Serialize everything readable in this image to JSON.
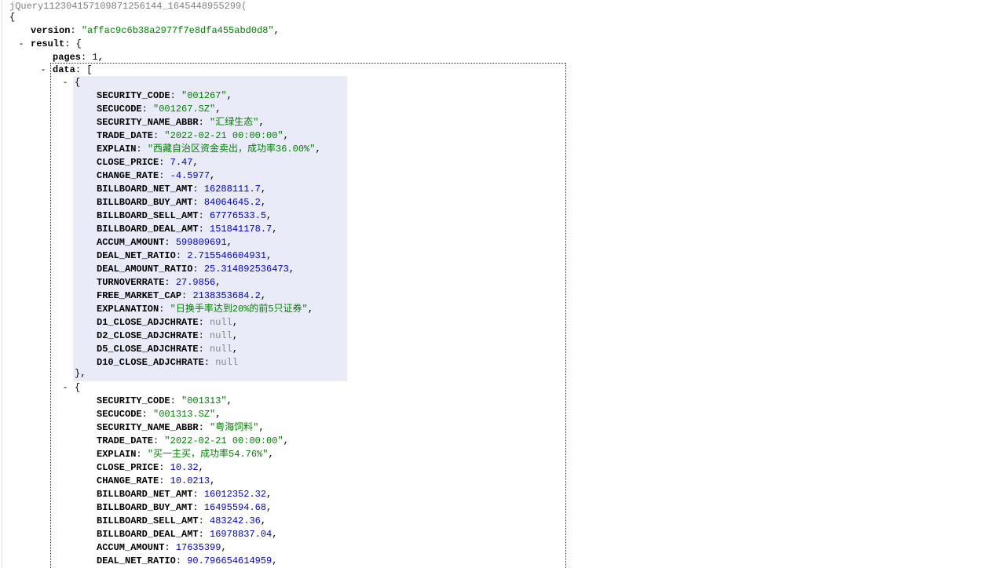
{
  "callback": "jQuery1123041571098712561­44_1645448955299(",
  "open_brace": "{",
  "root": {
    "version_key": "version",
    "version_value": "\"affac9c6b38a2977f7e8dfa455abd0d8\"",
    "result_key": "result",
    "pages_key": "pages",
    "pages_value": "1",
    "data_key": "data",
    "bracket_open": "[",
    "obj_open": "{",
    "obj_close": "},",
    "toggle_symbol": "-"
  },
  "records": [
    {
      "fields": [
        {
          "key": "SECURITY_CODE",
          "value": "\"001267\"",
          "type": "str",
          "sep": ","
        },
        {
          "key": "SECUCODE",
          "value": "\"001267.SZ\"",
          "type": "str",
          "sep": ","
        },
        {
          "key": "SECURITY_NAME_ABBR",
          "value": "\"汇绿生态\"",
          "type": "str",
          "sep": ","
        },
        {
          "key": "TRADE_DATE",
          "value": "\"2022-02-21 00:00:00\"",
          "type": "str",
          "sep": ","
        },
        {
          "key": "EXPLAIN",
          "value": "\"西藏自治区资金卖出，成功率36.00%\"",
          "type": "str",
          "sep": ","
        },
        {
          "key": "CLOSE_PRICE",
          "value": "7.47",
          "type": "num",
          "sep": ","
        },
        {
          "key": "CHANGE_RATE",
          "value": "-4.5977",
          "type": "num",
          "sep": ","
        },
        {
          "key": "BILLBOARD_NET_AMT",
          "value": "16288111.7",
          "type": "num",
          "sep": ","
        },
        {
          "key": "BILLBOARD_BUY_AMT",
          "value": "84064645.2",
          "type": "num",
          "sep": ","
        },
        {
          "key": "BILLBOARD_SELL_AMT",
          "value": "67776533.5",
          "type": "num",
          "sep": ","
        },
        {
          "key": "BILLBOARD_DEAL_AMT",
          "value": "151841178.7",
          "type": "num",
          "sep": ","
        },
        {
          "key": "ACCUM_AMOUNT",
          "value": "599809691",
          "type": "num",
          "sep": ","
        },
        {
          "key": "DEAL_NET_RATIO",
          "value": "2.715546604931",
          "type": "num",
          "sep": ","
        },
        {
          "key": "DEAL_AMOUNT_RATIO",
          "value": "25.314892536473",
          "type": "num",
          "sep": ","
        },
        {
          "key": "TURNOVERRATE",
          "value": "27.9856",
          "type": "num",
          "sep": ","
        },
        {
          "key": "FREE_MARKET_CAP",
          "value": "2138353684.2",
          "type": "num",
          "sep": ","
        },
        {
          "key": "EXPLANATION",
          "value": "\"日换手率达到20%的前5只证券\"",
          "type": "str",
          "sep": ","
        },
        {
          "key": "D1_CLOSE_ADJCHRATE",
          "value": "null",
          "type": "nul",
          "sep": ","
        },
        {
          "key": "D2_CLOSE_ADJCHRATE",
          "value": "null",
          "type": "nul",
          "sep": ","
        },
        {
          "key": "D5_CLOSE_ADJCHRATE",
          "value": "null",
          "type": "nul",
          "sep": ","
        },
        {
          "key": "D10_CLOSE_ADJCHRATE",
          "value": "null",
          "type": "nul",
          "sep": ""
        }
      ]
    },
    {
      "fields": [
        {
          "key": "SECURITY_CODE",
          "value": "\"001313\"",
          "type": "str",
          "sep": ","
        },
        {
          "key": "SECUCODE",
          "value": "\"001313.SZ\"",
          "type": "str",
          "sep": ","
        },
        {
          "key": "SECURITY_NAME_ABBR",
          "value": "\"粤海饲料\"",
          "type": "str",
          "sep": ","
        },
        {
          "key": "TRADE_DATE",
          "value": "\"2022-02-21 00:00:00\"",
          "type": "str",
          "sep": ","
        },
        {
          "key": "EXPLAIN",
          "value": "\"买一主买，成功率54.76%\"",
          "type": "str",
          "sep": ","
        },
        {
          "key": "CLOSE_PRICE",
          "value": "10.32",
          "type": "num",
          "sep": ","
        },
        {
          "key": "CHANGE_RATE",
          "value": "10.0213",
          "type": "num",
          "sep": ","
        },
        {
          "key": "BILLBOARD_NET_AMT",
          "value": "16012352.32",
          "type": "num",
          "sep": ","
        },
        {
          "key": "BILLBOARD_BUY_AMT",
          "value": "16495594.68",
          "type": "num",
          "sep": ","
        },
        {
          "key": "BILLBOARD_SELL_AMT",
          "value": "483242.36",
          "type": "num",
          "sep": ","
        },
        {
          "key": "BILLBOARD_DEAL_AMT",
          "value": "16978837.04",
          "type": "num",
          "sep": ","
        },
        {
          "key": "ACCUM_AMOUNT",
          "value": "17635399",
          "type": "num",
          "sep": ","
        },
        {
          "key": "DEAL_NET_RATIO",
          "value": "90.796654614959",
          "type": "num",
          "sep": ","
        }
      ]
    }
  ]
}
